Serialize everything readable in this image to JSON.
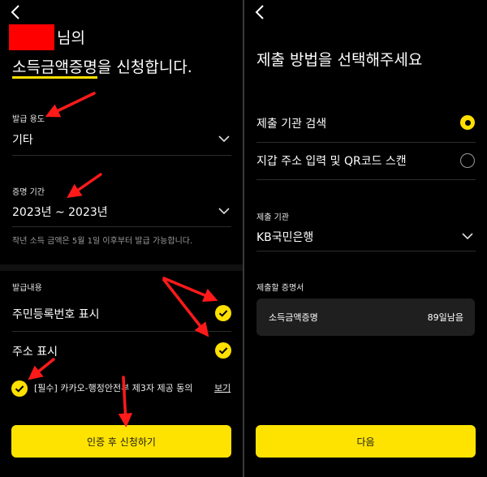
{
  "left": {
    "title_line1_suffix": "님의",
    "title_highlight": "소득금액증명",
    "title_line2_rest": "을 신청합니다.",
    "purpose": {
      "label": "발급 용도",
      "value": "기타"
    },
    "period": {
      "label": "증명 기간",
      "value": "2023년 ~ 2023년"
    },
    "period_note": "작년 소득 금액은 5월 1일 이후부터 발급 가능합니다.",
    "issue_contents_label": "발급내용",
    "options": [
      {
        "label": "주민등록번호 표시"
      },
      {
        "label": "주소 표시"
      }
    ],
    "consent": {
      "text": "[필수] 카카오-행정안전부 제3자 제공 동의",
      "view_link": "보기"
    },
    "submit_button": "인증 후 신청하기"
  },
  "right": {
    "title": "제출 방법을 선택해주세요",
    "methods": [
      {
        "label": "제출 기관 검색",
        "selected": true
      },
      {
        "label": "지갑 주소 입력 및 QR코드 스캔",
        "selected": false
      }
    ],
    "institution": {
      "label": "제출 기관",
      "value": "KB국민은행"
    },
    "certificates_label": "제출할 증명서",
    "certificate": {
      "name": "소득금액증명",
      "remaining": "89일남음"
    },
    "next_button": "다음"
  },
  "colors": {
    "accent": "#ffe300",
    "annotation_arrow": "#ff1a1a"
  }
}
